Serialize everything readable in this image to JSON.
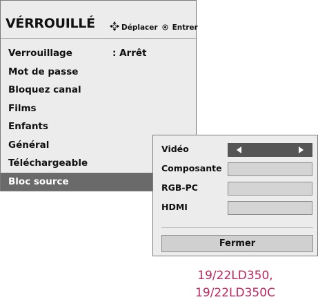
{
  "menu": {
    "title": "VÉRROUILLÉ",
    "hint_move": "Déplacer",
    "hint_enter": "Entrer",
    "items": [
      {
        "label": "Verrouillage",
        "value": ": Arrêt"
      },
      {
        "label": "Mot de passe"
      },
      {
        "label": "Bloquez canal"
      },
      {
        "label": "Films"
      },
      {
        "label": "Enfants"
      },
      {
        "label": "Général"
      },
      {
        "label": "Téléchargeable"
      },
      {
        "label": "Bloc source"
      }
    ]
  },
  "submenu": {
    "rows": [
      {
        "label": "Vidéo"
      },
      {
        "label": "Composante"
      },
      {
        "label": "RGB-PC"
      },
      {
        "label": "HDMI"
      }
    ],
    "close_label": "Fermer"
  },
  "caption": {
    "line1": "19/22LD350,",
    "line2": "19/22LD350C"
  },
  "colors": {
    "panel_bg": "#ececec",
    "selected_bg": "#6a6a6a",
    "active_box": "#555555",
    "caption": "#c0245a"
  },
  "icons": {
    "navigate": "four-way-arrows-icon",
    "ok": "ok-circle-icon",
    "left": "arrow-left-icon",
    "right": "arrow-right-icon"
  }
}
